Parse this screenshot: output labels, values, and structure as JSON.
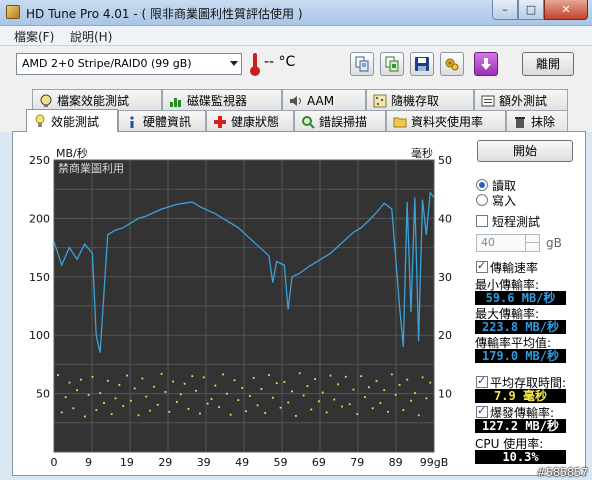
{
  "window": {
    "title": "HD Tune Pro 4.01 - ( 限非商業圖利性質評估使用 )",
    "minimize_label": "–",
    "maximize_label": "□",
    "close_label": "✕"
  },
  "menu": {
    "items": [
      "檔案(F)",
      "說明(H)"
    ]
  },
  "toolbar": {
    "drive": "AMD    2+0 Stripe/RAID0 (99 gB)",
    "temperature": "-- °C",
    "exit_label": "離開",
    "buttons": [
      "copy-text-icon",
      "copy-screen-icon",
      "save-icon",
      "options-icon",
      "download-icon"
    ]
  },
  "tabs": {
    "row1": [
      "檔案效能測試",
      "磁碟監視器",
      "AAM",
      "隨機存取",
      "額外測試"
    ],
    "row2": [
      "效能測試",
      "硬體資訊",
      "健康狀態",
      "錯誤掃描",
      "資料夾使用率",
      "抹除"
    ],
    "active": "效能測試"
  },
  "chart": {
    "left_unit": "MB/秒",
    "right_unit": "毫秒",
    "watermark": "禁商業圖利用"
  },
  "chart_data": {
    "type": "line",
    "x_label": "gB",
    "xlim": [
      0,
      99
    ],
    "x_ticks": [
      "0",
      "9",
      "19",
      "29",
      "39",
      "49",
      "59",
      "69",
      "79",
      "89",
      "99gB"
    ],
    "ylim_left": [
      0,
      250
    ],
    "y_ticks_left": [
      "250",
      "200",
      "150",
      "100",
      "50"
    ],
    "ylim_right": [
      0,
      50
    ],
    "y_ticks_right": [
      "50",
      "40",
      "30",
      "20",
      "10"
    ],
    "grid": true,
    "series": [
      {
        "axis": "left",
        "color": "#3aa2d6",
        "x": [
          0,
          2,
          4,
          6,
          8,
          10,
          11,
          12,
          14,
          16,
          18,
          20,
          22,
          24,
          26,
          28,
          30,
          32,
          34,
          36,
          38,
          40,
          42,
          44,
          46,
          48,
          50,
          52,
          54,
          56,
          57,
          58,
          60,
          61,
          62,
          64,
          66,
          68,
          70,
          72,
          74,
          76,
          78,
          80,
          82,
          84,
          86,
          88,
          90,
          91,
          92,
          93,
          94,
          95,
          96,
          97,
          98,
          99
        ],
        "y": [
          180,
          160,
          175,
          165,
          178,
          170,
          100,
          85,
          186,
          190,
          192,
          196,
          200,
          202,
          205,
          208,
          210,
          212,
          213,
          214,
          210,
          207,
          204,
          200,
          196,
          192,
          186,
          180,
          174,
          168,
          145,
          163,
          160,
          122,
          150,
          153,
          158,
          162,
          166,
          170,
          176,
          182,
          188,
          192,
          198,
          205,
          213,
          208,
          125,
          90,
          214,
          120,
          218,
          95,
          216,
          186,
          222,
          218
        ]
      }
    ],
    "access_time_points_ms": [
      [
        1,
        13.2
      ],
      [
        2,
        6.8
      ],
      [
        3,
        9.4
      ],
      [
        4,
        11.9
      ],
      [
        5,
        7.5
      ],
      [
        6,
        10.6
      ],
      [
        7,
        12.4
      ],
      [
        8,
        6.1
      ],
      [
        9,
        9.8
      ],
      [
        10,
        12.9
      ],
      [
        11,
        7.2
      ],
      [
        12,
        10.1
      ],
      [
        13,
        8.4
      ],
      [
        14,
        12.2
      ],
      [
        15,
        6.5
      ],
      [
        16,
        9.2
      ],
      [
        17,
        11.5
      ],
      [
        18,
        7.9
      ],
      [
        19,
        13.1
      ],
      [
        20,
        8.8
      ],
      [
        21,
        10.9
      ],
      [
        22,
        6.3
      ],
      [
        23,
        12.6
      ],
      [
        24,
        9.5
      ],
      [
        25,
        7.1
      ],
      [
        26,
        11.2
      ],
      [
        27,
        8.1
      ],
      [
        28,
        13.4
      ],
      [
        29,
        10.3
      ],
      [
        30,
        6.9
      ],
      [
        31,
        12.1
      ],
      [
        32,
        8.6
      ],
      [
        33,
        9.9
      ],
      [
        34,
        11.7
      ],
      [
        35,
        7.4
      ],
      [
        36,
        13.0
      ],
      [
        37,
        10.5
      ],
      [
        38,
        6.6
      ],
      [
        39,
        12.8
      ],
      [
        40,
        8.3
      ],
      [
        41,
        9.1
      ],
      [
        42,
        11.4
      ],
      [
        43,
        7.7
      ],
      [
        44,
        13.3
      ],
      [
        45,
        10.0
      ],
      [
        46,
        6.4
      ],
      [
        47,
        12.3
      ],
      [
        48,
        8.9
      ],
      [
        49,
        11.0
      ],
      [
        50,
        7.0
      ],
      [
        51,
        9.6
      ],
      [
        52,
        12.7
      ],
      [
        53,
        8.0
      ],
      [
        54,
        10.8
      ],
      [
        55,
        6.7
      ],
      [
        56,
        13.2
      ],
      [
        57,
        9.3
      ],
      [
        58,
        11.8
      ],
      [
        59,
        7.6
      ],
      [
        60,
        12.0
      ],
      [
        61,
        8.5
      ],
      [
        62,
        10.4
      ],
      [
        63,
        6.2
      ],
      [
        64,
        13.5
      ],
      [
        65,
        9.7
      ],
      [
        66,
        11.3
      ],
      [
        67,
        7.3
      ],
      [
        68,
        12.5
      ],
      [
        69,
        8.7
      ],
      [
        70,
        10.2
      ],
      [
        71,
        6.8
      ],
      [
        72,
        13.1
      ],
      [
        73,
        9.0
      ],
      [
        74,
        11.6
      ],
      [
        75,
        7.8
      ],
      [
        76,
        12.9
      ],
      [
        77,
        8.2
      ],
      [
        78,
        10.7
      ],
      [
        79,
        6.5
      ],
      [
        80,
        13.0
      ],
      [
        81,
        9.4
      ],
      [
        82,
        11.1
      ],
      [
        83,
        7.5
      ],
      [
        84,
        12.2
      ],
      [
        85,
        8.4
      ],
      [
        86,
        10.6
      ],
      [
        87,
        6.9
      ],
      [
        88,
        13.3
      ],
      [
        89,
        9.8
      ],
      [
        90,
        11.5
      ],
      [
        91,
        7.2
      ],
      [
        92,
        12.4
      ],
      [
        93,
        8.8
      ],
      [
        94,
        10.1
      ],
      [
        95,
        6.3
      ],
      [
        96,
        12.8
      ],
      [
        97,
        9.2
      ],
      [
        98,
        11.9
      ]
    ]
  },
  "panel": {
    "start_label": "開始",
    "read_label": "讀取",
    "write_label": "寫入",
    "short_test_label": "短程測試",
    "short_test_value": "40",
    "short_test_unit": "gB",
    "transfer_rate_label": "傳輸速率",
    "min_label": "最小傳輸率:",
    "min_value": "59.6 MB/秒",
    "max_label": "最大傳輸率:",
    "max_value": "223.8 MB/秒",
    "avg_label": "傳輸率平均值:",
    "avg_value": "179.0 MB/秒",
    "access_time_label": "平均存取時間:",
    "access_time_value": "7.9 毫秒",
    "burst_label": "爆發傳輸率:",
    "burst_value": "127.2 MB/秒",
    "cpu_label": "CPU 使用率:",
    "cpu_value": "10.3%"
  },
  "footer": {
    "tag": "#585857"
  }
}
